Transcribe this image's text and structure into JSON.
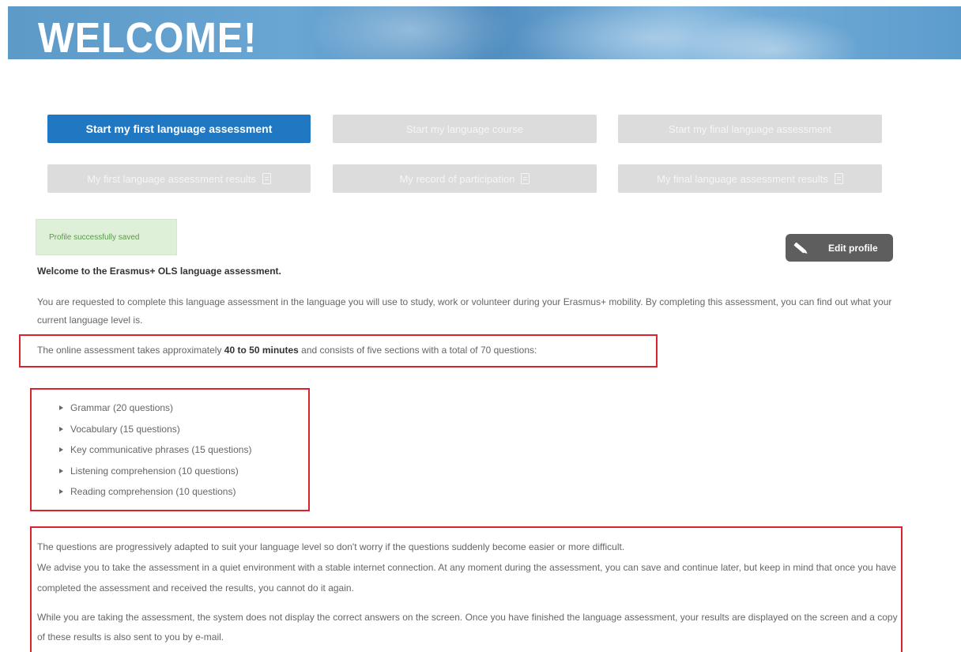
{
  "banner": {
    "title": "WELCOME!"
  },
  "actions": {
    "start_first": "Start my first language assessment",
    "start_course": "Start my language course",
    "start_final": "Start my final language assessment",
    "first_results": "My first language assessment results",
    "record": "My record of participation",
    "final_results": "My final language assessment results"
  },
  "notice": {
    "text": "Profile successfully saved"
  },
  "edit_profile": {
    "label": "Edit profile"
  },
  "intro": {
    "heading": "Welcome to the Erasmus+ OLS language assessment.",
    "p1": "You are requested to complete this language assessment in the language you will use to study, work or volunteer during your Erasmus+ mobility. By completing this assessment, you can find out what your current language level is.",
    "p2_start": "The online assessment takes approximately ",
    "p2_bold": "40 to 50 minutes",
    "p2_end": " and consists of five sections with a total of 70 questions:"
  },
  "sections": [
    "Grammar (20 questions)",
    "Vocabulary (15 questions)",
    "Key communicative phrases (15 questions)",
    "Listening comprehension (10 questions)",
    "Reading comprehension (10 questions)"
  ],
  "info": {
    "p1": "The questions are progressively adapted to suit your language level so don't worry if the questions suddenly become easier or more difficult.",
    "p2": "We advise you to take the assessment in a quiet environment with a stable internet connection. At any moment during the assessment, you can save and continue later, but keep in mind that once you have completed the assessment and received the results, you cannot do it again.",
    "p3": "While you are taking the assessment, the system does not display the correct answers on the screen. Once you have finished the language assessment, your results are displayed on the screen and a copy of these results is also sent to you by e-mail."
  },
  "colors": {
    "primary": "#1f78c1",
    "highlight_border": "#d9232f",
    "notice_bg": "#dff0d8"
  }
}
